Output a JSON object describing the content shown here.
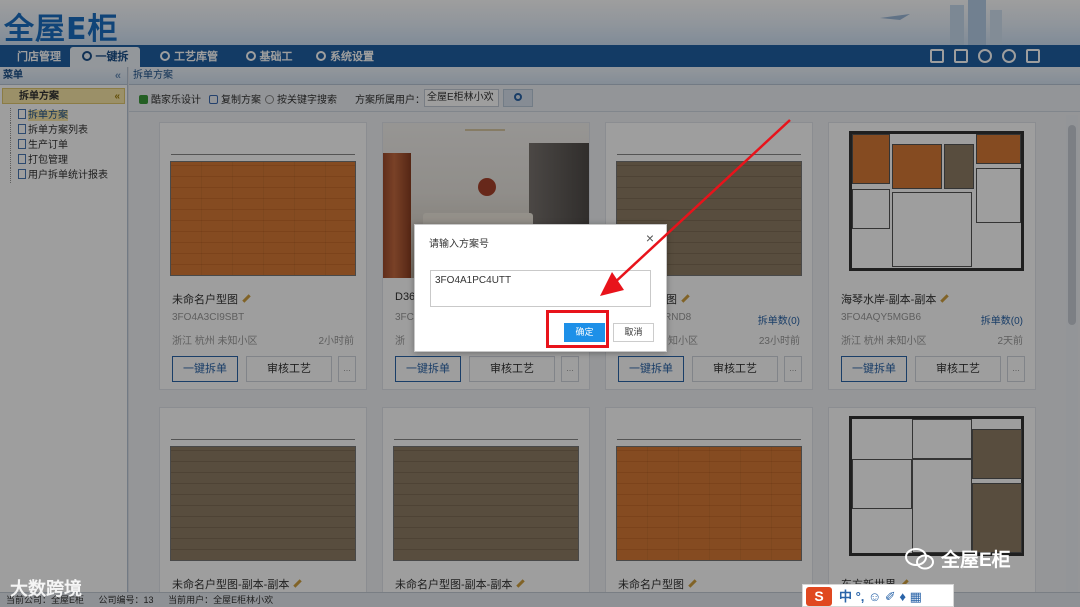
{
  "app": {
    "logo": "全屋E柜"
  },
  "nav": {
    "items": [
      {
        "label": "门店管理"
      },
      {
        "label": "一键拆单"
      },
      {
        "label": "工艺库管理"
      },
      {
        "label": "基础工艺"
      },
      {
        "label": "系统设置"
      }
    ],
    "active_index": 1
  },
  "sidebar": {
    "title": "菜单",
    "collapse": "«",
    "group": "拆单方案",
    "group_caret": "«",
    "items": [
      {
        "label": "拆单方案"
      },
      {
        "label": "拆单方案列表"
      },
      {
        "label": "生产订单"
      },
      {
        "label": "打包管理"
      },
      {
        "label": "用户拆单统计报表"
      }
    ]
  },
  "breadcrumb": "拆单方案",
  "toolbar": {
    "kujiale": "酷家乐设计",
    "copy": "复制方案",
    "search_kw": "按关键字搜索",
    "owner_label": "方案所属用户：",
    "owner_value": "全屋E柜林小欢"
  },
  "cards": [
    {
      "name": "未命名户型图",
      "code": "3FO4A3CI9SBT",
      "count": "",
      "loc": "浙江 杭州 未知小区",
      "time": "2小时前",
      "btn1": "一键拆单",
      "btn2": "审核工艺",
      "btn3": "..."
    },
    {
      "name": "D36",
      "code": "3FC",
      "count": "",
      "loc": "浙",
      "time": "",
      "btn1": "一键拆单",
      "btn2": "审核工艺",
      "btn3": "..."
    },
    {
      "name": "图",
      "code": "RND8",
      "count": "拆单数(0)",
      "loc": "知小区",
      "time": "23小时前",
      "btn1": "一键拆单",
      "btn2": "审核工艺",
      "btn3": "..."
    },
    {
      "name": "海琴水岸-副本-副本",
      "code": "3FO4AQY5MGB6",
      "count": "拆单数(0)",
      "loc": "浙江 杭州 未知小区",
      "time": "2天前",
      "btn1": "一键拆单",
      "btn2": "审核工艺",
      "btn3": "..."
    },
    {
      "name": "未命名户型图-副本-副本"
    },
    {
      "name": "未命名户型图-副本-副本"
    },
    {
      "name": "未命名户型图"
    },
    {
      "name": "东方新世界"
    }
  ],
  "dialog": {
    "title": "请输入方案号",
    "close": "×",
    "input_value": "3FO4A1PC4UTT",
    "ok": "确定",
    "cancel": "取消"
  },
  "status": {
    "company": "当前公司：全屋E柜",
    "company_no": "公司编号：13",
    "user": "当前用户：全屋E柜林小欢"
  },
  "watermarks": {
    "left": "大数跨境",
    "right": "全屋E柜"
  },
  "ime": {
    "logo": "S",
    "text": "中 °, ☺ ✐ ♦ ▦"
  },
  "colors": {
    "nav_bg": "#1f5fa3",
    "accent": "#1e90e8",
    "highlight": "#e8131b",
    "orange_floor": "#d77a36"
  }
}
